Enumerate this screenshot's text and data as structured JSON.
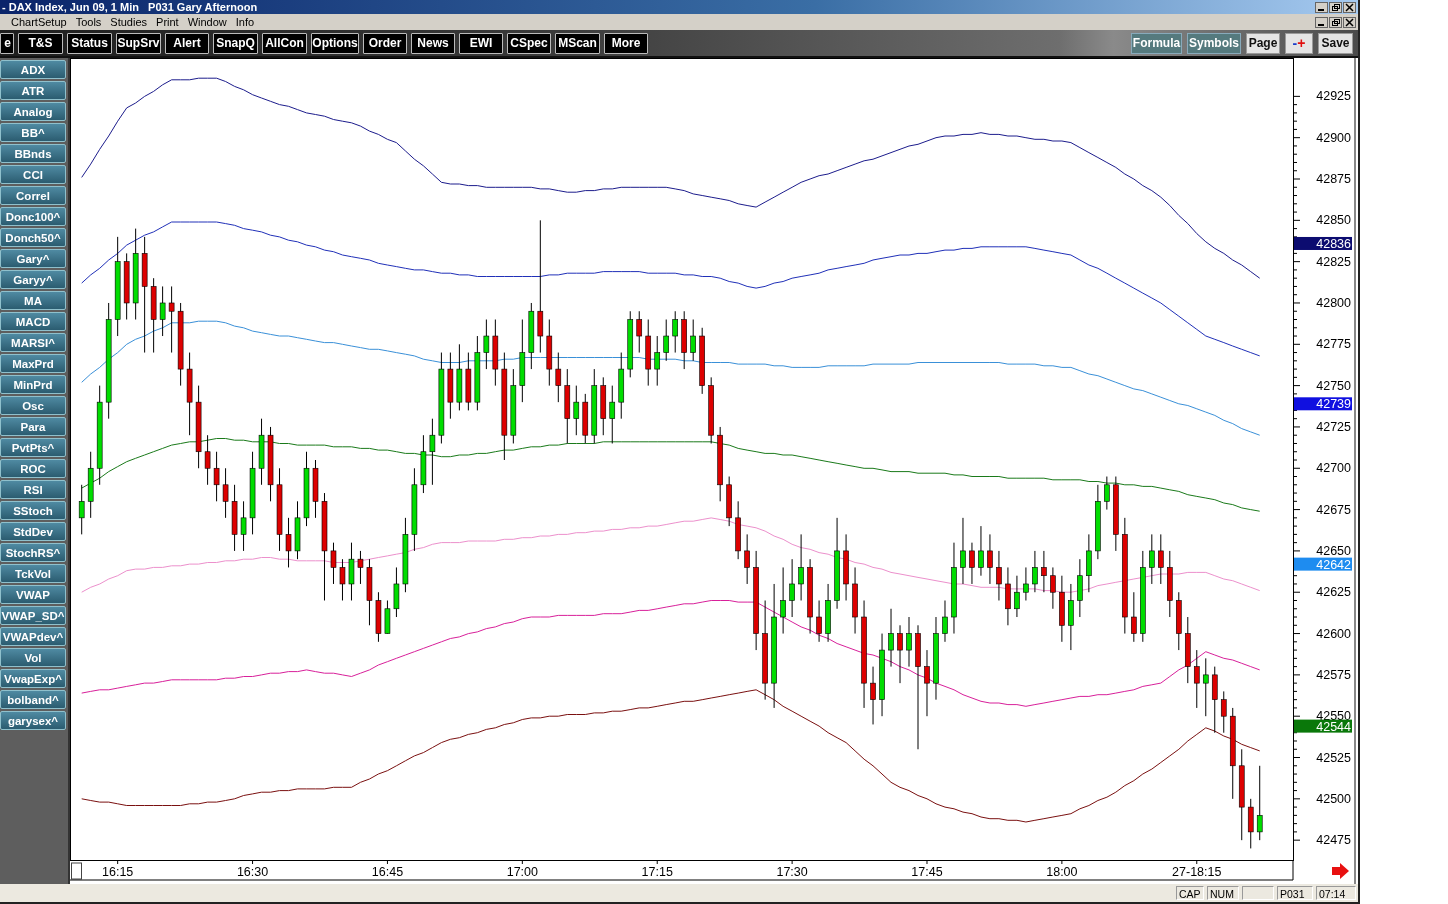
{
  "window": {
    "title": "- DAX Index, Jun 09, 1 Min   P031 Gary Afternoon"
  },
  "menu": [
    "ChartSetup",
    "Tools",
    "Studies",
    "Print",
    "Window",
    "Info"
  ],
  "toolbar": {
    "left": [
      "e",
      "T&S",
      "Status",
      "SupSrv",
      "Alert",
      "SnapQ",
      "AllCon",
      "Options",
      "Order",
      "News",
      "EWI",
      "CSpec",
      "MScan",
      "More"
    ],
    "right": [
      {
        "kind": "toggle",
        "label": "Formula"
      },
      {
        "kind": "toggle",
        "label": "Symbols"
      },
      {
        "kind": "plain",
        "label": "Page"
      },
      {
        "kind": "zoom",
        "parts": [
          {
            "text": "-",
            "color": "#1a3cc8"
          },
          {
            "text": "+",
            "color": "#e01010"
          }
        ]
      },
      {
        "kind": "plain",
        "label": "Save"
      }
    ]
  },
  "sidebar": {
    "items": [
      "ADX",
      "ATR",
      "Analog",
      "BB^",
      "BBnds",
      "CCI",
      "Correl",
      "Donc100^",
      "Donch50^",
      "Gary^",
      "Garyy^",
      "MA",
      "MACD",
      "MARSI^",
      "MaxPrd",
      "MinPrd",
      "Osc",
      "Para",
      "PvtPts^",
      "ROC",
      "RSI",
      "SStoch",
      "StdDev",
      "StochRS^",
      "TckVol",
      "VWAP",
      "VWAP_SD^",
      "VWAPdev^",
      "Vol",
      "VwapExp^",
      "bolband^",
      "garysex^"
    ]
  },
  "chart": {
    "chart_data": {
      "type": "candlestick",
      "ylim": [
        42463,
        42947
      ],
      "yticks": [
        42475,
        42500,
        42525,
        42550,
        42575,
        42600,
        42625,
        42650,
        42675,
        42700,
        42725,
        42750,
        42775,
        42800,
        42825,
        42850,
        42875,
        42900,
        42925
      ],
      "categories": [
        null,
        null,
        null,
        null,
        "16:15",
        null,
        null,
        null,
        null,
        null,
        null,
        null,
        null,
        null,
        null,
        null,
        null,
        null,
        null,
        "16:30",
        null,
        null,
        null,
        null,
        null,
        null,
        null,
        null,
        null,
        null,
        null,
        null,
        null,
        null,
        "16:45",
        null,
        null,
        null,
        null,
        null,
        null,
        null,
        null,
        null,
        null,
        null,
        null,
        null,
        null,
        "17:00",
        null,
        null,
        null,
        null,
        null,
        null,
        null,
        null,
        null,
        null,
        null,
        null,
        null,
        null,
        "17:15",
        null,
        null,
        null,
        null,
        null,
        null,
        null,
        null,
        null,
        null,
        null,
        null,
        null,
        null,
        "17:30",
        null,
        null,
        null,
        null,
        null,
        null,
        null,
        null,
        null,
        null,
        null,
        null,
        null,
        null,
        "17:45",
        null,
        null,
        null,
        null,
        null,
        null,
        null,
        null,
        null,
        null,
        null,
        null,
        null,
        null,
        "18:00",
        null,
        null,
        null,
        null,
        null,
        null,
        null,
        null,
        null,
        null,
        null,
        null,
        null,
        null,
        "27-18:15",
        null,
        null,
        null,
        null,
        null,
        null,
        null
      ],
      "ohlc": [
        [
          42670,
          42690,
          42660,
          42680
        ],
        [
          42680,
          42710,
          42670,
          42700
        ],
        [
          42700,
          42750,
          42690,
          42740
        ],
        [
          42740,
          42800,
          42730,
          42790
        ],
        [
          42790,
          42840,
          42780,
          42825
        ],
        [
          42825,
          42830,
          42790,
          42800
        ],
        [
          42800,
          42845,
          42790,
          42830
        ],
        [
          42830,
          42840,
          42770,
          42810
        ],
        [
          42810,
          42815,
          42770,
          42790
        ],
        [
          42790,
          42810,
          42780,
          42800
        ],
        [
          42800,
          42810,
          42770,
          42795
        ],
        [
          42795,
          42800,
          42750,
          42760
        ],
        [
          42760,
          42770,
          42720,
          42740
        ],
        [
          42740,
          42750,
          42700,
          42710
        ],
        [
          42710,
          42720,
          42690,
          42700
        ],
        [
          42700,
          42710,
          42680,
          42690
        ],
        [
          42690,
          42700,
          42670,
          42680
        ],
        [
          42680,
          42690,
          42650,
          42660
        ],
        [
          42660,
          42680,
          42650,
          42670
        ],
        [
          42670,
          42710,
          42660,
          42700
        ],
        [
          42700,
          42730,
          42690,
          42720
        ],
        [
          42720,
          42725,
          42680,
          42690
        ],
        [
          42690,
          42700,
          42650,
          42660
        ],
        [
          42660,
          42670,
          42640,
          42650
        ],
        [
          42650,
          42680,
          42645,
          42670
        ],
        [
          42670,
          42710,
          42665,
          42700
        ],
        [
          42700,
          42705,
          42670,
          42680
        ],
        [
          42680,
          42685,
          42620,
          42650
        ],
        [
          42650,
          42655,
          42630,
          42640
        ],
        [
          42640,
          42645,
          42620,
          42630
        ],
        [
          42630,
          42655,
          42620,
          42645
        ],
        [
          42645,
          42650,
          42630,
          42640
        ],
        [
          42640,
          42645,
          42605,
          42620
        ],
        [
          42620,
          42625,
          42595,
          42600
        ],
        [
          42600,
          42620,
          42600,
          42615
        ],
        [
          42615,
          42640,
          42610,
          42630
        ],
        [
          42630,
          42670,
          42625,
          42660
        ],
        [
          42660,
          42700,
          42650,
          42690
        ],
        [
          42690,
          42720,
          42685,
          42710
        ],
        [
          42710,
          42730,
          42690,
          42720
        ],
        [
          42720,
          42770,
          42715,
          42760
        ],
        [
          42760,
          42770,
          42730,
          42740
        ],
        [
          42740,
          42775,
          42735,
          42760
        ],
        [
          42760,
          42770,
          42735,
          42740
        ],
        [
          42740,
          42780,
          42735,
          42770
        ],
        [
          42770,
          42790,
          42760,
          42780
        ],
        [
          42780,
          42790,
          42750,
          42760
        ],
        [
          42760,
          42770,
          42705,
          42720
        ],
        [
          42720,
          42760,
          42715,
          42750
        ],
        [
          42750,
          42790,
          42740,
          42770
        ],
        [
          42770,
          42800,
          42760,
          42795
        ],
        [
          42795,
          42850,
          42770,
          42780
        ],
        [
          42780,
          42790,
          42750,
          42760
        ],
        [
          42760,
          42770,
          42740,
          42750
        ],
        [
          42750,
          42760,
          42715,
          42730
        ],
        [
          42730,
          42750,
          42720,
          42740
        ],
        [
          42740,
          42745,
          42715,
          42720
        ],
        [
          42720,
          42760,
          42715,
          42750
        ],
        [
          42750,
          42755,
          42720,
          42730
        ],
        [
          42730,
          42750,
          42715,
          42740
        ],
        [
          42740,
          42770,
          42730,
          42760
        ],
        [
          42760,
          42795,
          42755,
          42790
        ],
        [
          42790,
          42795,
          42770,
          42780
        ],
        [
          42780,
          42790,
          42750,
          42760
        ],
        [
          42760,
          42780,
          42750,
          42770
        ],
        [
          42770,
          42790,
          42765,
          42780
        ],
        [
          42780,
          42795,
          42770,
          42790
        ],
        [
          42790,
          42795,
          42760,
          42770
        ],
        [
          42770,
          42790,
          42765,
          42780
        ],
        [
          42780,
          42785,
          42745,
          42750
        ],
        [
          42750,
          42755,
          42715,
          42720
        ],
        [
          42720,
          42725,
          42680,
          42690
        ],
        [
          42690,
          42695,
          42665,
          42670
        ],
        [
          42670,
          42680,
          42645,
          42650
        ],
        [
          42650,
          42660,
          42630,
          42640
        ],
        [
          42640,
          42650,
          42590,
          42600
        ],
        [
          42600,
          42620,
          42560,
          42570
        ],
        [
          42570,
          42630,
          42555,
          42610
        ],
        [
          42610,
          42640,
          42600,
          42620
        ],
        [
          42620,
          42645,
          42610,
          42630
        ],
        [
          42630,
          42660,
          42620,
          42640
        ],
        [
          42640,
          42645,
          42600,
          42610
        ],
        [
          42610,
          42620,
          42595,
          42600
        ],
        [
          42600,
          42630,
          42595,
          42620
        ],
        [
          42620,
          42670,
          42615,
          42650
        ],
        [
          42650,
          42660,
          42620,
          42630
        ],
        [
          42630,
          42640,
          42600,
          42610
        ],
        [
          42610,
          42620,
          42555,
          42570
        ],
        [
          42570,
          42580,
          42545,
          42560
        ],
        [
          42560,
          42600,
          42550,
          42590
        ],
        [
          42590,
          42615,
          42580,
          42600
        ],
        [
          42600,
          42605,
          42570,
          42590
        ],
        [
          42590,
          42610,
          42580,
          42600
        ],
        [
          42600,
          42605,
          42530,
          42580
        ],
        [
          42580,
          42590,
          42550,
          42570
        ],
        [
          42570,
          42610,
          42560,
          42600
        ],
        [
          42600,
          42620,
          42595,
          42610
        ],
        [
          42610,
          42655,
          42600,
          42640
        ],
        [
          42640,
          42670,
          42630,
          42650
        ],
        [
          42650,
          42655,
          42630,
          42640
        ],
        [
          42640,
          42665,
          42635,
          42650
        ],
        [
          42650,
          42660,
          42630,
          42640
        ],
        [
          42640,
          42650,
          42620,
          42630
        ],
        [
          42630,
          42640,
          42605,
          42615
        ],
        [
          42615,
          42635,
          42610,
          42625
        ],
        [
          42625,
          42640,
          42620,
          42630
        ],
        [
          42630,
          42650,
          42625,
          42640
        ],
        [
          42640,
          42650,
          42625,
          42635
        ],
        [
          42635,
          42640,
          42615,
          42625
        ],
        [
          42625,
          42635,
          42595,
          42605
        ],
        [
          42605,
          42630,
          42590,
          42620
        ],
        [
          42620,
          42645,
          42610,
          42635
        ],
        [
          42635,
          42660,
          42625,
          42650
        ],
        [
          42650,
          42690,
          42645,
          42680
        ],
        [
          42680,
          42695,
          42675,
          42690
        ],
        [
          42690,
          42695,
          42650,
          42660
        ],
        [
          42660,
          42670,
          42600,
          42610
        ],
        [
          42610,
          42625,
          42595,
          42600
        ],
        [
          42600,
          42650,
          42595,
          42640
        ],
        [
          42640,
          42660,
          42630,
          42650
        ],
        [
          42650,
          42660,
          42630,
          42640
        ],
        [
          42640,
          42650,
          42610,
          42620
        ],
        [
          42620,
          42625,
          42590,
          42600
        ],
        [
          42600,
          42610,
          42570,
          42580
        ],
        [
          42580,
          42590,
          42555,
          42570
        ],
        [
          42570,
          42585,
          42550,
          42575
        ],
        [
          42575,
          42580,
          42540,
          42560
        ],
        [
          42560,
          42565,
          42540,
          42550
        ],
        [
          42550,
          42555,
          42500,
          42520
        ],
        [
          42520,
          42530,
          42475,
          42495
        ],
        [
          42495,
          42500,
          42470,
          42480
        ],
        [
          42480,
          42520,
          42475,
          42490
        ]
      ],
      "series": [
        {
          "type": "line",
          "color": "#1c1c8c",
          "values": [
            42876,
            42884,
            42893,
            42901,
            42910,
            42918,
            42921,
            42925,
            42928,
            42932,
            42935,
            42935,
            42935,
            42936,
            42936,
            42936,
            42934,
            42931,
            42929,
            42926,
            42924,
            42922,
            42920,
            42919,
            42917,
            42915,
            42914,
            42913,
            42911,
            42910,
            42909,
            42907,
            42904,
            42902,
            42899,
            42897,
            42892,
            42887,
            42883,
            42878,
            42873,
            42872,
            42872,
            42871,
            42871,
            42870,
            42870,
            42870,
            42870,
            42870,
            42870,
            42869,
            42869,
            42868,
            42867,
            42867,
            42868,
            42868,
            42869,
            42869,
            42870,
            42870,
            42870,
            42870,
            42870,
            42870,
            42869,
            42868,
            42866,
            42865,
            42864,
            42863,
            42862,
            42860,
            42859,
            42858,
            42861,
            42864,
            42867,
            42870,
            42873,
            42875,
            42877,
            42878,
            42880,
            42882,
            42884,
            42886,
            42887,
            42889,
            42891,
            42893,
            42895,
            42896,
            42898,
            42900,
            42901,
            42901,
            42902,
            42902,
            42903,
            42902,
            42902,
            42901,
            42901,
            42900,
            42899,
            42899,
            42898,
            42898,
            42897,
            42894,
            42891,
            42888,
            42885,
            42882,
            42878,
            42875,
            42871,
            42868,
            42864,
            42859,
            42853,
            42848,
            42842,
            42837,
            42833,
            42830,
            42826,
            42823,
            42819,
            42815
          ]
        },
        {
          "type": "line",
          "color": "#2030b8",
          "values": [
            42812,
            42817,
            42821,
            42826,
            42830,
            42835,
            42838,
            42841,
            42843,
            42846,
            42849,
            42849,
            42849,
            42849,
            42849,
            42849,
            42848,
            42847,
            42845,
            42844,
            42843,
            42841,
            42840,
            42838,
            42837,
            42835,
            42834,
            42832,
            42831,
            42829,
            42828,
            42827,
            42826,
            42824,
            42823,
            42822,
            42821,
            42820,
            42820,
            42819,
            42818,
            42818,
            42817,
            42817,
            42816,
            42816,
            42816,
            42816,
            42816,
            42816,
            42816,
            42816,
            42817,
            42817,
            42818,
            42818,
            42818,
            42818,
            42819,
            42819,
            42819,
            42819,
            42819,
            42818,
            42818,
            42818,
            42818,
            42817,
            42817,
            42816,
            42816,
            42815,
            42813,
            42812,
            42810,
            42809,
            42810,
            42812,
            42813,
            42815,
            42816,
            42817,
            42818,
            42820,
            42821,
            42822,
            42823,
            42824,
            42826,
            42827,
            42828,
            42829,
            42829,
            42830,
            42830,
            42831,
            42832,
            42832,
            42833,
            42833,
            42834,
            42834,
            42834,
            42834,
            42834,
            42834,
            42833,
            42832,
            42831,
            42830,
            42829,
            42826,
            42823,
            42821,
            42818,
            42815,
            42812,
            42809,
            42806,
            42803,
            42800,
            42796,
            42792,
            42788,
            42784,
            42780,
            42778,
            42776,
            42774,
            42772,
            42770,
            42768
          ]
        },
        {
          "type": "line",
          "color": "#3a90d8",
          "values": [
            42752,
            42757,
            42761,
            42766,
            42770,
            42775,
            42778,
            42780,
            42783,
            42785,
            42788,
            42788,
            42788,
            42789,
            42789,
            42789,
            42788,
            42786,
            42785,
            42783,
            42782,
            42781,
            42780,
            42780,
            42779,
            42778,
            42777,
            42776,
            42776,
            42775,
            42774,
            42773,
            42772,
            42772,
            42771,
            42770,
            42769,
            42768,
            42766,
            42765,
            42764,
            42764,
            42764,
            42765,
            42765,
            42765,
            42765,
            42766,
            42766,
            42767,
            42767,
            42767,
            42767,
            42767,
            42767,
            42767,
            42767,
            42767,
            42767,
            42767,
            42767,
            42767,
            42767,
            42766,
            42766,
            42766,
            42766,
            42765,
            42765,
            42764,
            42764,
            42764,
            42764,
            42763,
            42763,
            42763,
            42763,
            42762,
            42762,
            42761,
            42761,
            42761,
            42761,
            42762,
            42762,
            42762,
            42762,
            42762,
            42763,
            42763,
            42763,
            42763,
            42763,
            42764,
            42764,
            42764,
            42764,
            42764,
            42764,
            42764,
            42764,
            42764,
            42764,
            42763,
            42763,
            42763,
            42763,
            42762,
            42762,
            42761,
            42761,
            42759,
            42757,
            42756,
            42754,
            42752,
            42750,
            42748,
            42747,
            42745,
            42743,
            42741,
            42739,
            42738,
            42736,
            42734,
            42732,
            42729,
            42727,
            42724,
            42722,
            42720
          ]
        },
        {
          "type": "line",
          "color": "#1a7a1a",
          "values": [
            42688,
            42691,
            42694,
            42698,
            42701,
            42704,
            42706,
            42708,
            42710,
            42712,
            42714,
            42715,
            42716,
            42716,
            42717,
            42718,
            42718,
            42717,
            42717,
            42716,
            42716,
            42716,
            42715,
            42715,
            42714,
            42714,
            42714,
            42714,
            42713,
            42713,
            42713,
            42712,
            42712,
            42711,
            42711,
            42710,
            42709,
            42709,
            42708,
            42708,
            42707,
            42707,
            42708,
            42708,
            42709,
            42709,
            42710,
            42711,
            42711,
            42712,
            42713,
            42713,
            42714,
            42714,
            42715,
            42715,
            42715,
            42715,
            42716,
            42716,
            42716,
            42716,
            42716,
            42716,
            42716,
            42716,
            42716,
            42716,
            42716,
            42716,
            42716,
            42715,
            42714,
            42712,
            42711,
            42710,
            42709,
            42709,
            42708,
            42708,
            42707,
            42706,
            42705,
            42704,
            42703,
            42702,
            42701,
            42700,
            42700,
            42699,
            42698,
            42698,
            42698,
            42697,
            42697,
            42697,
            42697,
            42696,
            42696,
            42695,
            42695,
            42695,
            42695,
            42694,
            42694,
            42694,
            42694,
            42694,
            42693,
            42693,
            42693,
            42693,
            42692,
            42692,
            42691,
            42691,
            42690,
            42690,
            42689,
            42689,
            42688,
            42687,
            42686,
            42684,
            42683,
            42682,
            42681,
            42679,
            42678,
            42676,
            42675,
            42674
          ]
        },
        {
          "type": "line",
          "color": "#ec90cc",
          "values": [
            42625,
            42628,
            42630,
            42633,
            42635,
            42638,
            42639,
            42639,
            42640,
            42640,
            42641,
            42641,
            42642,
            42642,
            42643,
            42643,
            42644,
            42644,
            42645,
            42645,
            42646,
            42646,
            42645,
            42645,
            42644,
            42644,
            42644,
            42644,
            42643,
            42643,
            42643,
            42644,
            42645,
            42646,
            42647,
            42648,
            42649,
            42651,
            42652,
            42654,
            42655,
            42655,
            42655,
            42656,
            42656,
            42656,
            42656,
            42657,
            42657,
            42658,
            42658,
            42659,
            42659,
            42660,
            42660,
            42661,
            42661,
            42662,
            42662,
            42663,
            42663,
            42664,
            42664,
            42665,
            42665,
            42666,
            42667,
            42668,
            42668,
            42669,
            42670,
            42669,
            42668,
            42666,
            42665,
            42664,
            42662,
            42659,
            42657,
            42654,
            42652,
            42651,
            42649,
            42648,
            42646,
            42645,
            42643,
            42642,
            42640,
            42639,
            42637,
            42636,
            42635,
            42634,
            42633,
            42632,
            42631,
            42630,
            42630,
            42629,
            42628,
            42628,
            42628,
            42627,
            42627,
            42627,
            42627,
            42626,
            42626,
            42625,
            42625,
            42626,
            42627,
            42629,
            42630,
            42631,
            42632,
            42633,
            42634,
            42635,
            42636,
            42636,
            42636,
            42637,
            42637,
            42637,
            42635,
            42633,
            42632,
            42630,
            42628,
            42626
          ]
        },
        {
          "type": "line",
          "color": "#d8209a",
          "values": [
            42564,
            42565,
            42566,
            42566,
            42567,
            42568,
            42569,
            42570,
            42570,
            42571,
            42572,
            42572,
            42572,
            42572,
            42572,
            42572,
            42573,
            42573,
            42574,
            42574,
            42575,
            42576,
            42576,
            42577,
            42577,
            42578,
            42577,
            42576,
            42576,
            42575,
            42574,
            42576,
            42578,
            42581,
            42583,
            42585,
            42587,
            42589,
            42591,
            42593,
            42595,
            42597,
            42598,
            42600,
            42601,
            42603,
            42604,
            42606,
            42607,
            42609,
            42610,
            42610,
            42610,
            42611,
            42611,
            42611,
            42611,
            42611,
            42612,
            42612,
            42612,
            42613,
            42614,
            42614,
            42615,
            42616,
            42617,
            42618,
            42618,
            42619,
            42620,
            42620,
            42620,
            42619,
            42619,
            42619,
            42616,
            42613,
            42610,
            42607,
            42604,
            42602,
            42599,
            42597,
            42594,
            42592,
            42590,
            42588,
            42587,
            42585,
            42583,
            42580,
            42578,
            42575,
            42573,
            42570,
            42568,
            42566,
            42563,
            42561,
            42559,
            42558,
            42558,
            42557,
            42557,
            42556,
            42557,
            42558,
            42559,
            42560,
            42561,
            42562,
            42562,
            42563,
            42563,
            42564,
            42565,
            42566,
            42568,
            42569,
            42570,
            42574,
            42578,
            42581,
            42585,
            42589,
            42587,
            42585,
            42584,
            42582,
            42580,
            42578
          ]
        },
        {
          "type": "line",
          "color": "#7a1010",
          "values": [
            42500,
            42499,
            42498,
            42498,
            42497,
            42496,
            42496,
            42496,
            42496,
            42496,
            42496,
            42496,
            42497,
            42497,
            42498,
            42498,
            42499,
            42500,
            42502,
            42503,
            42504,
            42504,
            42505,
            42505,
            42506,
            42506,
            42506,
            42506,
            42507,
            42507,
            42507,
            42510,
            42512,
            42515,
            42517,
            42520,
            42523,
            42526,
            42528,
            42531,
            42534,
            42536,
            42537,
            42539,
            42540,
            42542,
            42543,
            42545,
            42546,
            42548,
            42549,
            42549,
            42550,
            42550,
            42551,
            42551,
            42551,
            42552,
            42552,
            42553,
            42553,
            42554,
            42555,
            42555,
            42556,
            42557,
            42558,
            42559,
            42559,
            42560,
            42561,
            42562,
            42563,
            42564,
            42565,
            42566,
            42563,
            42560,
            42556,
            42553,
            42550,
            42547,
            42544,
            42540,
            42537,
            42534,
            42529,
            42524,
            42520,
            42515,
            42510,
            42507,
            42505,
            42502,
            42500,
            42497,
            42495,
            42494,
            42492,
            42491,
            42489,
            42488,
            42488,
            42487,
            42487,
            42486,
            42487,
            42488,
            42489,
            42490,
            42491,
            42494,
            42496,
            42499,
            42501,
            42504,
            42508,
            42511,
            42515,
            42518,
            42522,
            42526,
            42530,
            42535,
            42539,
            42543,
            42541,
            42538,
            42536,
            42533,
            42531,
            42529
          ]
        }
      ]
    }
  },
  "status_bar": [
    "CAP",
    "NUM",
    "P031",
    "07:14"
  ],
  "price_tags": [
    {
      "text": "42836",
      "color": "#0c0c70"
    },
    {
      "text": "42739",
      "color": "#1010e0"
    },
    {
      "text": "42642",
      "color": "#1e8cf0"
    },
    {
      "text": "42544",
      "color": "#0a780a"
    }
  ]
}
